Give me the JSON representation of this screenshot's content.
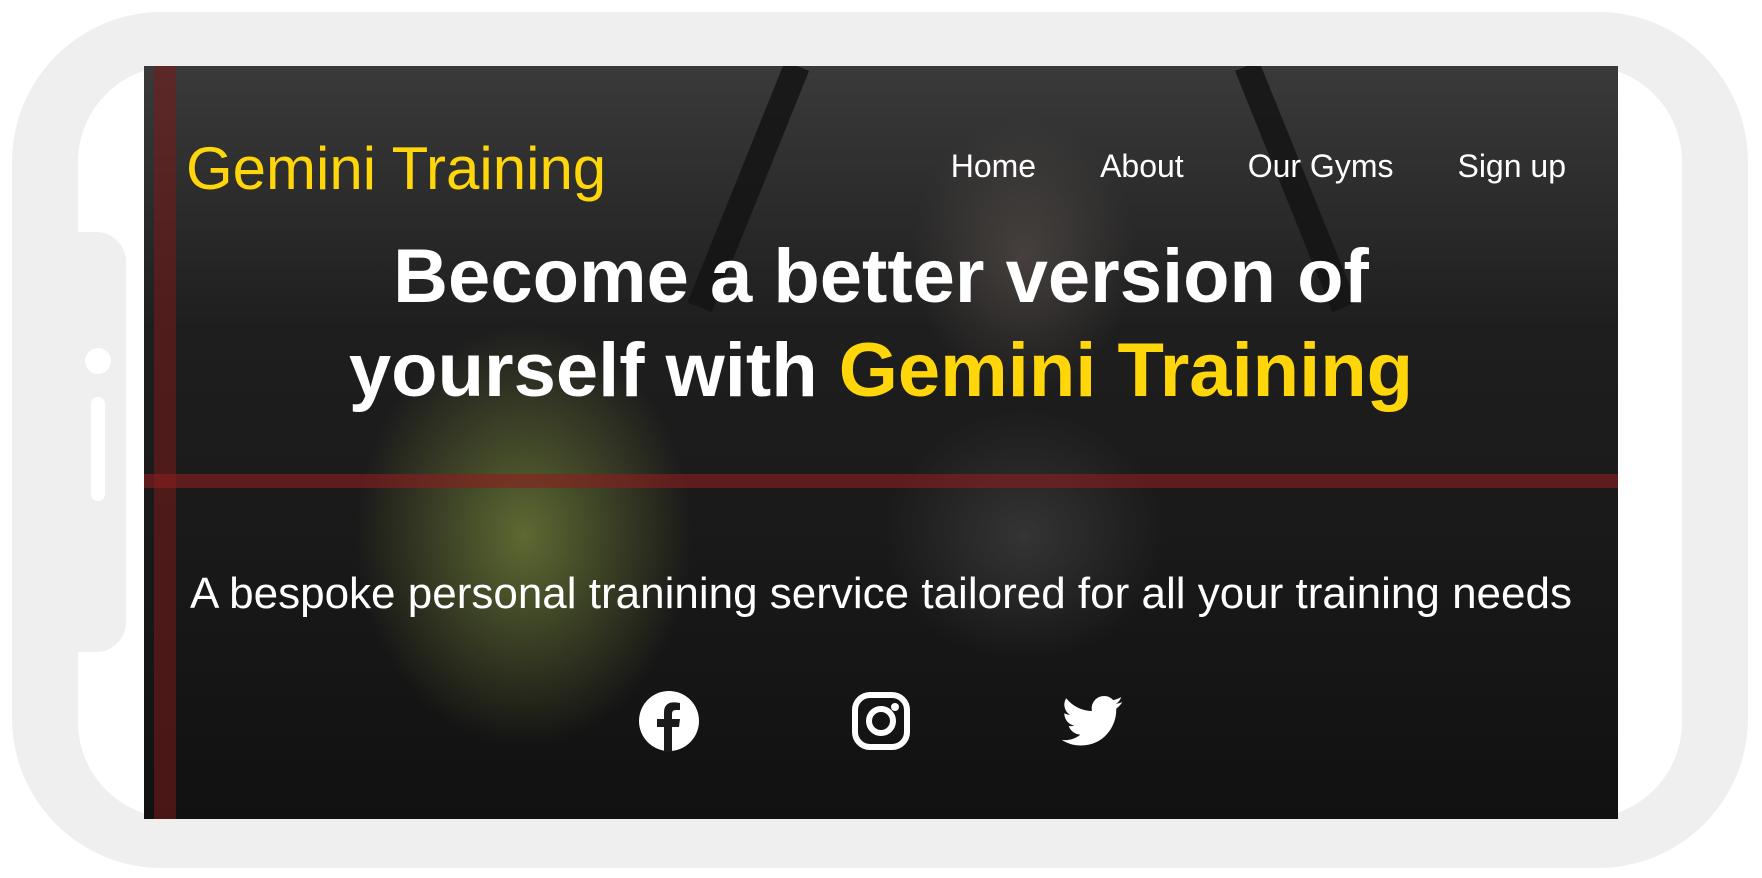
{
  "brand": {
    "logo_text": "Gemini Training",
    "accent_color": "#ffd60a"
  },
  "nav": {
    "items": [
      {
        "label": "Home"
      },
      {
        "label": "About"
      },
      {
        "label": "Our Gyms"
      },
      {
        "label": "Sign up"
      }
    ]
  },
  "hero": {
    "headline_line1": "Become a better version of",
    "headline_line2_prefix": "yourself with",
    "headline_highlight": "Gemini Training",
    "tagline": "A bespoke personal tranining service tailored for all your training needs"
  },
  "socials": [
    {
      "icon": "facebook-icon"
    },
    {
      "icon": "instagram-icon"
    },
    {
      "icon": "twitter-icon"
    }
  ]
}
